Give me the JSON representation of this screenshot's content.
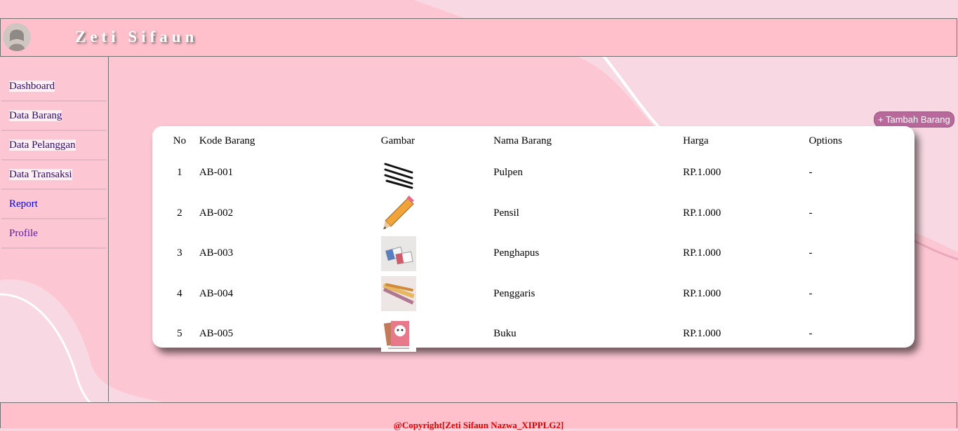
{
  "header": {
    "brand": "Zeti Sifaun"
  },
  "sidebar": {
    "items": [
      {
        "label": "Dashboard"
      },
      {
        "label": "Data Barang"
      },
      {
        "label": "Data Pelanggan"
      },
      {
        "label": "Data Transaksi"
      },
      {
        "label": "Report"
      },
      {
        "label": "Profile"
      }
    ]
  },
  "toolbar": {
    "add_label": "+ Tambah Barang"
  },
  "table": {
    "headers": [
      "No",
      "Kode Barang",
      "Gambar",
      "Nama Barang",
      "Harga",
      "Options"
    ],
    "rows": [
      {
        "no": "1",
        "kode": "AB-001",
        "gambar": "pulpen-image",
        "nama": "Pulpen",
        "harga": "RP.1.000",
        "options": "-"
      },
      {
        "no": "2",
        "kode": "AB-002",
        "gambar": "pensil-image",
        "nama": "Pensil",
        "harga": "RP.1.000",
        "options": "-"
      },
      {
        "no": "3",
        "kode": "AB-003",
        "gambar": "penghapus-image",
        "nama": "Penghapus",
        "harga": "RP.1.000",
        "options": "-"
      },
      {
        "no": "4",
        "kode": "AB-004",
        "gambar": "penggaris-image",
        "nama": "Penggaris",
        "harga": "RP.1.000",
        "options": "-"
      },
      {
        "no": "5",
        "kode": "AB-005",
        "gambar": "buku-image",
        "nama": "Buku",
        "harga": "RP.1.000",
        "options": "-"
      }
    ]
  },
  "footer": {
    "copyright": "@Copyright[Zeti Sifaun Nazwa_XIPPLG2]"
  },
  "colors": {
    "header_bg": "#ffc0cb",
    "accent_button": "#b8689a",
    "footer_text": "#e00000"
  }
}
